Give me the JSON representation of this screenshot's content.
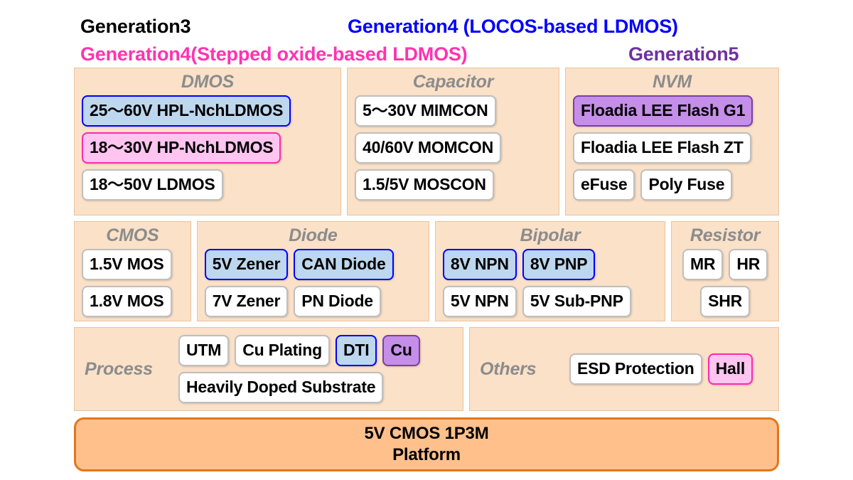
{
  "legend": {
    "items": [
      {
        "label": "Generation3",
        "color": "#000000"
      },
      {
        "label": "Generation4 (LOCOS-based LDMOS)",
        "color": "#0000ff"
      },
      {
        "label": "Generation4(Stepped oxide-based LDMOS)",
        "color": "#ff33b0"
      },
      {
        "label": "Generation5",
        "color": "#7030a0"
      }
    ]
  },
  "row1": {
    "dmos": {
      "title": "DMOS",
      "chips": [
        {
          "label": "25〜60V HPL-NchLDMOS",
          "gen": "gen4locos"
        },
        {
          "label": "18〜30V HP-NchLDMOS",
          "gen": "gen4stepped"
        },
        {
          "label": "18〜50V LDMOS",
          "gen": "gen3"
        }
      ]
    },
    "capacitor": {
      "title": "Capacitor",
      "chips": [
        {
          "label": "5〜30V MIMCON",
          "gen": "gen3"
        },
        {
          "label": "40/60V MOMCON",
          "gen": "gen3"
        },
        {
          "label": "1.5/5V MOSCON",
          "gen": "gen3"
        }
      ]
    },
    "nvm": {
      "title": "NVM",
      "chips": [
        {
          "label": "Floadia LEE Flash G1",
          "gen": "gen5"
        },
        {
          "label": "Floadia LEE Flash ZT",
          "gen": "gen3"
        },
        {
          "label": "eFuse",
          "gen": "gen3"
        },
        {
          "label": "Poly Fuse",
          "gen": "gen3"
        }
      ]
    }
  },
  "row2": {
    "cmos": {
      "title": "CMOS",
      "chips": [
        {
          "label": "1.5V MOS",
          "gen": "gen3"
        },
        {
          "label": "1.8V MOS",
          "gen": "gen3"
        }
      ]
    },
    "diode": {
      "title": "Diode",
      "chips": [
        {
          "label": "5V Zener",
          "gen": "gen4locos"
        },
        {
          "label": "CAN Diode",
          "gen": "gen4locos"
        },
        {
          "label": "7V Zener",
          "gen": "gen3"
        },
        {
          "label": "PN Diode",
          "gen": "gen3"
        }
      ]
    },
    "bipolar": {
      "title": "Bipolar",
      "chips": [
        {
          "label": "8V NPN",
          "gen": "gen4locos"
        },
        {
          "label": "8V PNP",
          "gen": "gen4locos"
        },
        {
          "label": "5V NPN",
          "gen": "gen3"
        },
        {
          "label": "5V Sub-PNP",
          "gen": "gen3"
        }
      ]
    },
    "resistor": {
      "title": "Resistor",
      "chips": [
        {
          "label": "MR",
          "gen": "gen3"
        },
        {
          "label": "HR",
          "gen": "gen3"
        },
        {
          "label": "SHR",
          "gen": "gen3"
        }
      ]
    }
  },
  "row3": {
    "process": {
      "title": "Process",
      "chips": [
        {
          "label": "UTM",
          "gen": "gen3"
        },
        {
          "label": "Cu Plating",
          "gen": "gen3"
        },
        {
          "label": "DTI",
          "gen": "gen4locos"
        },
        {
          "label": "Cu",
          "gen": "gen5"
        },
        {
          "label": "Heavily Doped Substrate",
          "gen": "gen3"
        }
      ]
    },
    "others": {
      "title": "Others",
      "chips": [
        {
          "label": "ESD Protection",
          "gen": "gen3"
        },
        {
          "label": "Hall",
          "gen": "gen4stepped"
        }
      ]
    }
  },
  "platform": {
    "line1": "5V CMOS 1P3M",
    "line2": "Platform",
    "fill": "#ffc08c",
    "border": "#e3761b"
  }
}
